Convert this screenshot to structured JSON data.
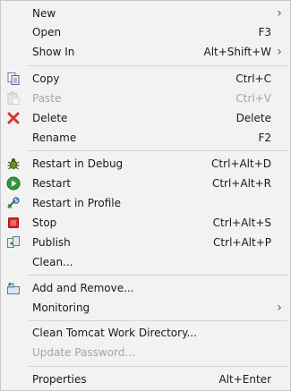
{
  "menu": {
    "new": {
      "label": "New"
    },
    "open": {
      "label": "Open",
      "accel": "F3"
    },
    "show_in": {
      "label": "Show In",
      "accel": "Alt+Shift+W"
    },
    "copy": {
      "label": "Copy",
      "accel": "Ctrl+C"
    },
    "paste": {
      "label": "Paste",
      "accel": "Ctrl+V"
    },
    "delete": {
      "label": "Delete",
      "accel": "Delete"
    },
    "rename": {
      "label": "Rename",
      "accel": "F2"
    },
    "restart_debug": {
      "label": "Restart in Debug",
      "accel": "Ctrl+Alt+D"
    },
    "restart": {
      "label": "Restart",
      "accel": "Ctrl+Alt+R"
    },
    "restart_profile": {
      "label": "Restart in Profile"
    },
    "stop": {
      "label": "Stop",
      "accel": "Ctrl+Alt+S"
    },
    "publish": {
      "label": "Publish",
      "accel": "Ctrl+Alt+P"
    },
    "clean": {
      "label": "Clean..."
    },
    "add_remove": {
      "label": "Add and Remove..."
    },
    "monitoring": {
      "label": "Monitoring"
    },
    "clean_tomcat": {
      "label": "Clean Tomcat Work Directory..."
    },
    "update_password": {
      "label": "Update Password..."
    },
    "properties": {
      "label": "Properties",
      "accel": "Alt+Enter"
    },
    "submenu_arrow": "›"
  },
  "icons": {
    "copy": "copy-icon",
    "paste": "paste-icon",
    "delete": "delete-icon",
    "restart_debug": "debug-bug-icon",
    "restart": "run-icon",
    "restart_profile": "profile-icon",
    "stop": "stop-icon",
    "publish": "publish-icon",
    "add_remove": "add-remove-icon"
  },
  "colors": {
    "background": "#f2f2f2",
    "separator": "#d3d3d3",
    "disabled_text": "#a5a5a5",
    "delete_red": "#d9372b",
    "run_green": "#2f9a3a",
    "stop_red": "#d92a2a"
  }
}
